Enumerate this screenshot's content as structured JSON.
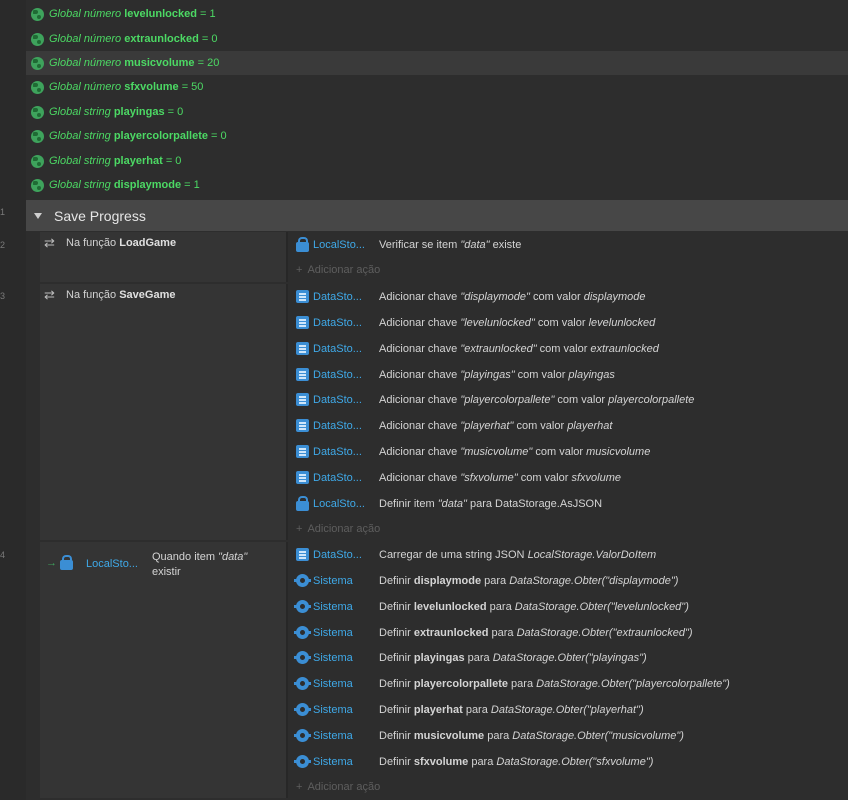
{
  "line_numbers": [
    "1",
    "2",
    "3",
    "4"
  ],
  "globals": [
    {
      "kind": "Global número",
      "name": "levelunlocked",
      "value": "= 1"
    },
    {
      "kind": "Global número",
      "name": "extraunlocked",
      "value": "= 0"
    },
    {
      "kind": "Global número",
      "name": "musicvolume",
      "value": "= 20"
    },
    {
      "kind": "Global número",
      "name": "sfxvolume",
      "value": "= 50"
    },
    {
      "kind": "Global string",
      "name": "playingas",
      "value": "= 0"
    },
    {
      "kind": "Global string",
      "name": "playercolorpallete",
      "value": "= 0"
    },
    {
      "kind": "Global string",
      "name": "playerhat",
      "value": "= 0"
    },
    {
      "kind": "Global string",
      "name": "displaymode",
      "value": "= 1"
    }
  ],
  "group": {
    "title": "Save Progress"
  },
  "add_action_label": "Adicionar ação",
  "events": [
    {
      "condition": {
        "prefix": "Na função",
        "name": "LoadGame"
      },
      "actions": [
        {
          "object": "LocalSto...",
          "icon": "lock-icon",
          "text": "Verificar se item ",
          "q": "\"data\"",
          "tail": " existe"
        }
      ]
    },
    {
      "condition": {
        "prefix": "Na função",
        "name": "SaveGame"
      },
      "actions": [
        {
          "object": "DataSto...",
          "icon": "storage-icon",
          "text": "Adicionar chave ",
          "q": "\"displaymode\"",
          "mid": " com valor ",
          "v": "displaymode"
        },
        {
          "object": "DataSto...",
          "icon": "storage-icon",
          "text": "Adicionar chave ",
          "q": "\"levelunlocked\"",
          "mid": " com valor ",
          "v": "levelunlocked"
        },
        {
          "object": "DataSto...",
          "icon": "storage-icon",
          "text": "Adicionar chave ",
          "q": "\"extraunlocked\"",
          "mid": " com valor ",
          "v": "extraunlocked"
        },
        {
          "object": "DataSto...",
          "icon": "storage-icon",
          "text": "Adicionar chave ",
          "q": "\"playingas\"",
          "mid": " com valor ",
          "v": "playingas"
        },
        {
          "object": "DataSto...",
          "icon": "storage-icon",
          "text": "Adicionar chave ",
          "q": "\"playercolorpallete\"",
          "mid": " com valor ",
          "v": "playercolorpallete"
        },
        {
          "object": "DataSto...",
          "icon": "storage-icon",
          "text": "Adicionar chave ",
          "q": "\"playerhat\"",
          "mid": " com valor ",
          "v": "playerhat"
        },
        {
          "object": "DataSto...",
          "icon": "storage-icon",
          "text": "Adicionar chave ",
          "q": "\"musicvolume\"",
          "mid": " com valor ",
          "v": "musicvolume"
        },
        {
          "object": "DataSto...",
          "icon": "storage-icon",
          "text": "Adicionar chave ",
          "q": "\"sfxvolume\"",
          "mid": " com valor ",
          "v": "sfxvolume"
        },
        {
          "object": "LocalSto...",
          "icon": "lock-icon",
          "text": "Definir item ",
          "q": "\"data\"",
          "mid": " para DataStorage.AsJSON",
          "v": ""
        }
      ]
    },
    {
      "condition": {
        "object": "LocalSto...",
        "text1": "Quando item ",
        "q": "\"data\"",
        "text2": "existir"
      },
      "actions": [
        {
          "object": "DataSto...",
          "icon": "storage-icon",
          "text": "Carregar de uma string JSON ",
          "v": "LocalStorage.ValorDoItem"
        },
        {
          "object": "Sistema",
          "icon": "gear-icon",
          "text": "Definir ",
          "b": "displaymode",
          "mid": " para ",
          "v": "DataStorage.Obter(\"displaymode\")"
        },
        {
          "object": "Sistema",
          "icon": "gear-icon",
          "text": "Definir ",
          "b": "levelunlocked",
          "mid": " para ",
          "v": "DataStorage.Obter(\"levelunlocked\")"
        },
        {
          "object": "Sistema",
          "icon": "gear-icon",
          "text": "Definir ",
          "b": "extraunlocked",
          "mid": " para ",
          "v": "DataStorage.Obter(\"extraunlocked\")"
        },
        {
          "object": "Sistema",
          "icon": "gear-icon",
          "text": "Definir ",
          "b": "playingas",
          "mid": " para ",
          "v": "DataStorage.Obter(\"playingas\")"
        },
        {
          "object": "Sistema",
          "icon": "gear-icon",
          "text": "Definir ",
          "b": "playercolorpallete",
          "mid": " para ",
          "v": "DataStorage.Obter(\"playercolorpallete\")"
        },
        {
          "object": "Sistema",
          "icon": "gear-icon",
          "text": "Definir ",
          "b": "playerhat",
          "mid": " para ",
          "v": "DataStorage.Obter(\"playerhat\")"
        },
        {
          "object": "Sistema",
          "icon": "gear-icon",
          "text": "Definir ",
          "b": "musicvolume",
          "mid": " para ",
          "v": "DataStorage.Obter(\"musicvolume\")"
        },
        {
          "object": "Sistema",
          "icon": "gear-icon",
          "text": "Definir ",
          "b": "sfxvolume",
          "mid": " para ",
          "v": "DataStorage.Obter(\"sfxvolume\")"
        }
      ]
    }
  ]
}
